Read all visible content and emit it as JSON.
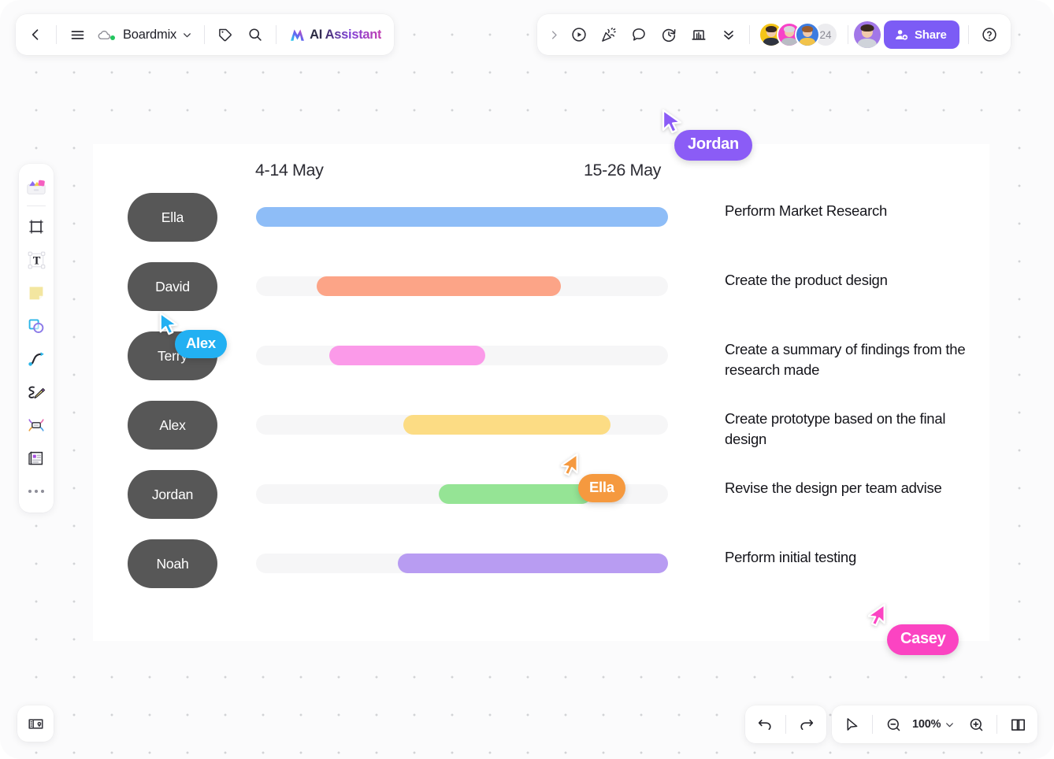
{
  "app": {
    "document_name": "Boardmix",
    "ai_assistant_label": "AI Assistant"
  },
  "topbar_left": {
    "back_icon": "back-chevron-icon",
    "menu_icon": "hamburger-menu-icon",
    "cloud_icon": "cloud-saved-icon",
    "doc_caret_icon": "chevron-down-icon",
    "tag_icon": "tag-icon",
    "search_icon": "search-icon",
    "ai_logo_icon": "ai-sparkle-logo-icon"
  },
  "topbar_right": {
    "expand_icon": "chevron-right-icon",
    "present_icon": "play-circle-icon",
    "celebrate_icon": "party-popper-icon",
    "comment_icon": "chat-bubble-icon",
    "timer_icon": "timer-icon",
    "chart_icon": "bar-chart-icon",
    "more_icon": "chevrons-down-icon",
    "collaborator_count": "24",
    "share_label": "Share",
    "share_icon": "person-add-icon",
    "help_icon": "help-circle-icon",
    "share_color": "#7c5cf5",
    "avatars": [
      {
        "name": "collaborator-1",
        "bg": "#f5c518",
        "hair": "#3a2a22",
        "shirt": "#2f3440"
      },
      {
        "name": "collaborator-2",
        "bg": "#f742c8",
        "hair": "#d8d8dc",
        "shirt": "#b9bcc4"
      },
      {
        "name": "collaborator-3",
        "bg": "#3d7ce0",
        "hair": "#9a5c2e",
        "shirt": "#f2c34a"
      }
    ],
    "me_avatar": {
      "name": "current-user-avatar",
      "bg": "#a277e8",
      "hair": "#3b2a20",
      "shirt": "#cfd3da"
    }
  },
  "left_rail": [
    {
      "name": "templates-tool",
      "icon": "templates-icon"
    },
    {
      "name": "frame-tool",
      "icon": "frame-icon"
    },
    {
      "name": "text-tool",
      "icon": "text-t-icon"
    },
    {
      "name": "sticky-note-tool",
      "icon": "sticky-note-icon"
    },
    {
      "name": "shapes-tool",
      "icon": "shapes-icon"
    },
    {
      "name": "connector-tool",
      "icon": "curve-connector-icon"
    },
    {
      "name": "pen-tool",
      "icon": "pencil-scribble-icon"
    },
    {
      "name": "mindmap-tool",
      "icon": "mind-map-icon"
    },
    {
      "name": "document-tool",
      "icon": "document-icon"
    },
    {
      "name": "more-tools",
      "icon": "ellipsis-icon"
    }
  ],
  "board": {
    "column_headers": [
      "4-14 May",
      "15-26 May"
    ],
    "rows": [
      {
        "assignee": "Ella",
        "task": "Perform Market Research",
        "bar_color": "#8ebdf7",
        "bar_start_pct": 0,
        "bar_end_pct": 100,
        "show_track": false
      },
      {
        "assignee": "David",
        "task": "Create the product design",
        "bar_color": "#fca487",
        "bar_start_pct": 14.7,
        "bar_end_pct": 74.0,
        "show_track": true
      },
      {
        "assignee": "Terry",
        "task": "Create a summary of findings from the research made",
        "bar_color": "#fb9ae9",
        "bar_start_pct": 17.8,
        "bar_end_pct": 55.6,
        "show_track": true
      },
      {
        "assignee": "Alex",
        "task": "Create prototype based on the final design",
        "bar_color": "#fcdc84",
        "bar_start_pct": 35.8,
        "bar_end_pct": 86.0,
        "show_track": true
      },
      {
        "assignee": "Jordan",
        "task": "Revise the design per team advise",
        "bar_color": "#95e495",
        "bar_start_pct": 44.4,
        "bar_end_pct": 81.5,
        "show_track": true
      },
      {
        "assignee": "Noah",
        "task": "Perform initial testing",
        "bar_color": "#b89cf2",
        "bar_start_pct": 34.4,
        "bar_end_pct": 100,
        "show_track": true
      }
    ]
  },
  "cursors": [
    {
      "name": "Jordan",
      "color": "#8b5cf6"
    },
    {
      "name": "Alex",
      "color": "#22b0f2"
    },
    {
      "name": "Ella",
      "color": "#f5993f"
    },
    {
      "name": "Casey",
      "color": "#fb44c2"
    }
  ],
  "bottom_bar": {
    "minimap_panel_icon": "map-panel-icon",
    "undo_icon": "undo-arrow-icon",
    "redo_icon": "redo-arrow-icon",
    "select_icon": "cursor-arrow-icon",
    "zoom_out_icon": "zoom-out-icon",
    "zoom_in_icon": "zoom-in-icon",
    "zoom_caret_icon": "chevron-down-icon",
    "zoom_level": "100%",
    "minimap_icon": "open-book-map-icon"
  }
}
